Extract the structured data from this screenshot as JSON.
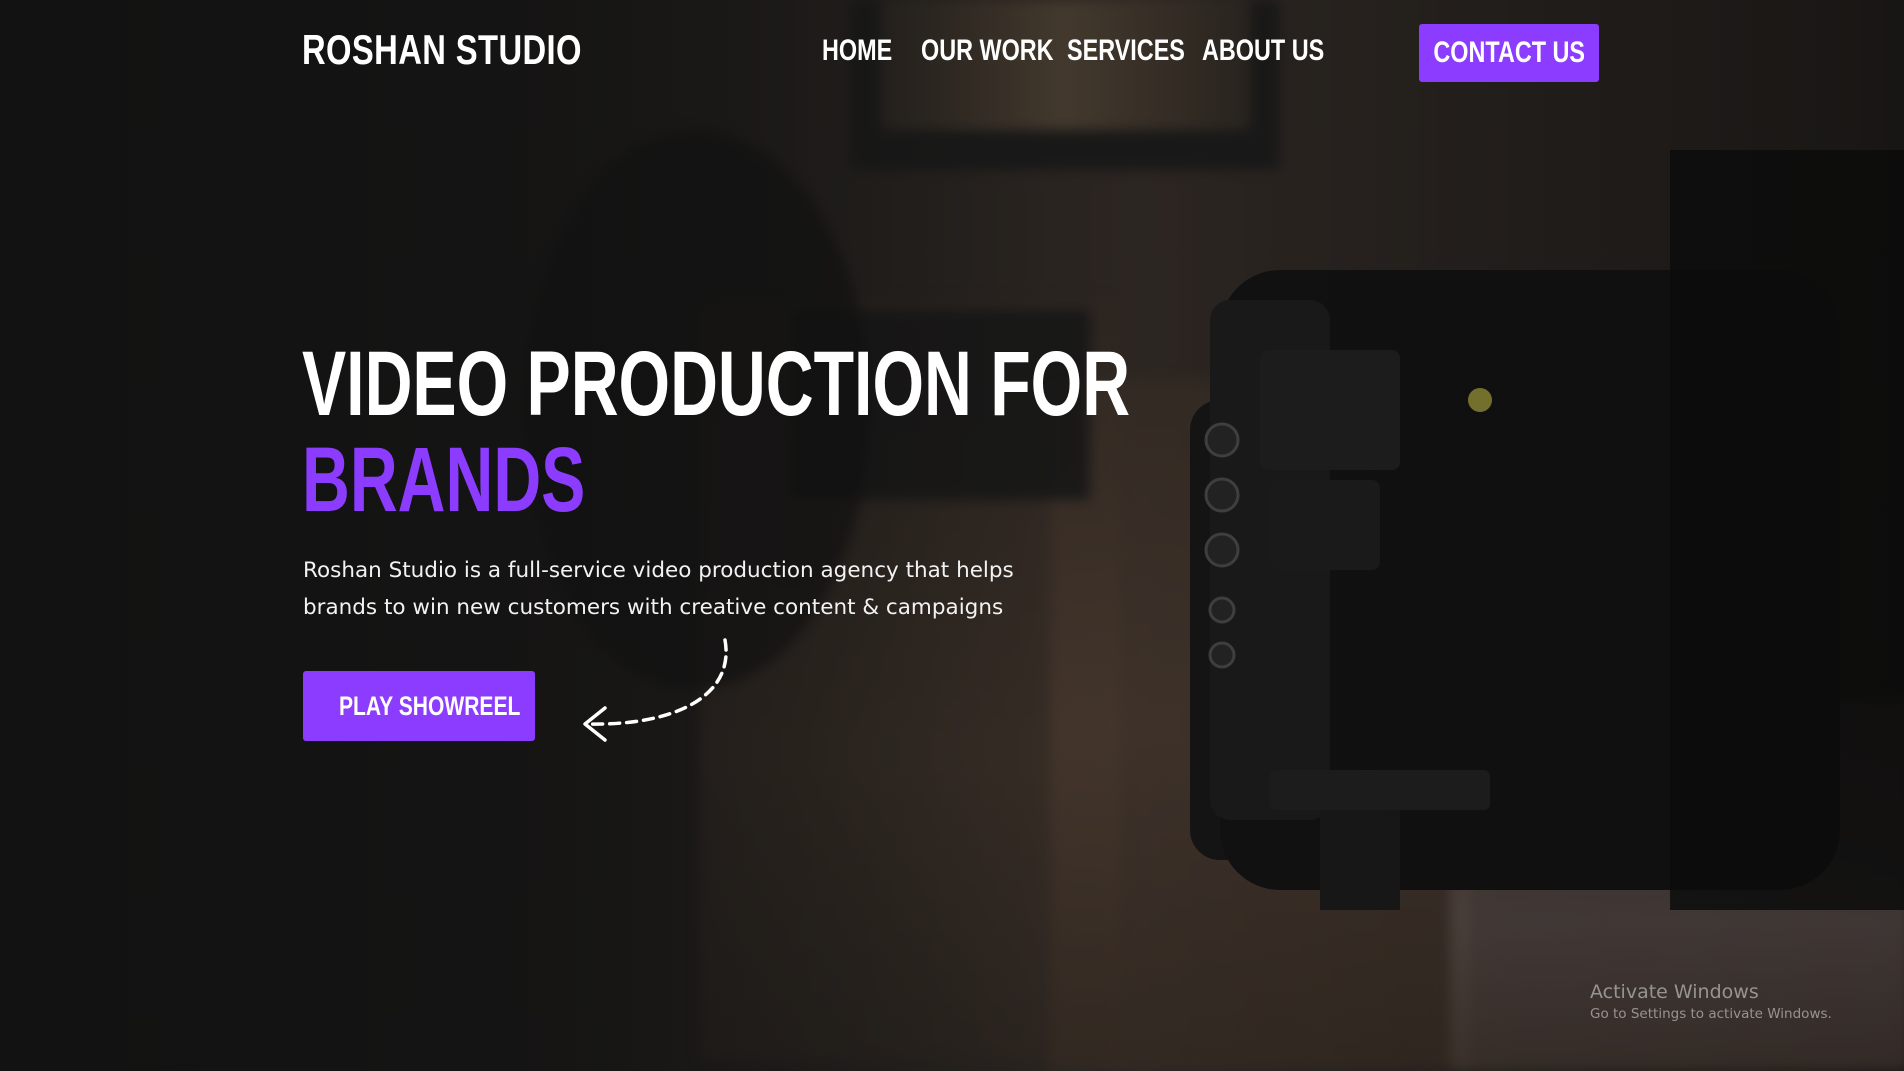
{
  "header": {
    "logo": "ROSHAN STUDIO",
    "nav": [
      {
        "label": "HOME"
      },
      {
        "label": "OUR WORK"
      },
      {
        "label": "SERVICES"
      },
      {
        "label": "ABOUT US"
      }
    ],
    "contact_label": "CONTACT US"
  },
  "hero": {
    "headline_line1": "VIDEO PRODUCTION FOR",
    "headline_accent": "BRANDS",
    "subtext": "Roshan Studio is a full-service video production agency that helps brands to win new customers with creative content & campaigns",
    "play_label": "PLAY SHOWREEL"
  },
  "watermark": {
    "title": "Activate Windows",
    "subtitle": "Go to Settings to activate Windows."
  },
  "colors": {
    "accent": "#8c3cff",
    "text": "#ffffff",
    "background": "#141414"
  },
  "icons": {
    "play": "play-icon",
    "arrow": "dashed-curved-arrow-icon"
  }
}
